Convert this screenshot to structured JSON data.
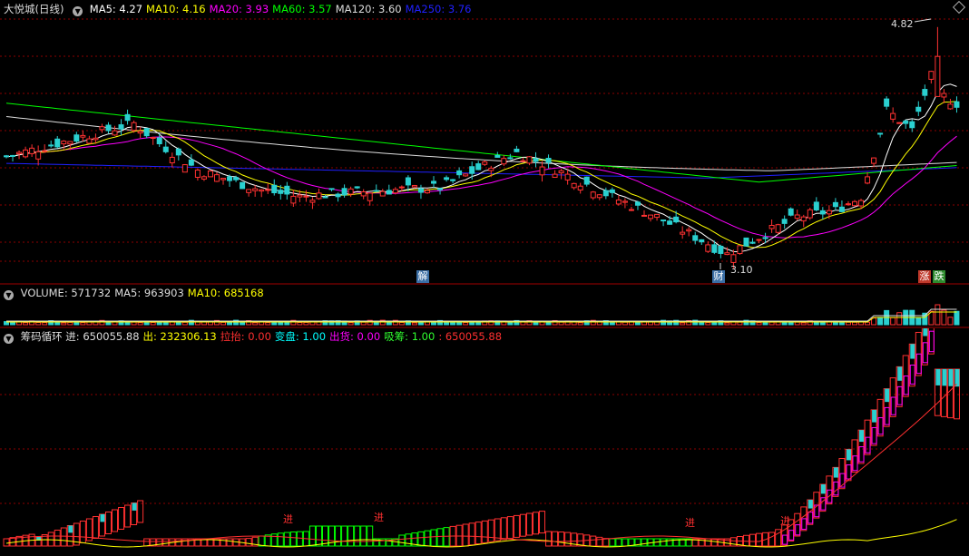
{
  "main_panel": {
    "title": "大悦城(日线)",
    "ma_labels": [
      {
        "text": "MA5: 4.27",
        "color": "#ffffff"
      },
      {
        "text": "MA10: 4.16",
        "color": "#ffff00"
      },
      {
        "text": "MA20: 3.93",
        "color": "#ff00ff"
      },
      {
        "text": "MA60: 3.57",
        "color": "#00ff00"
      },
      {
        "text": "MA120: 3.60",
        "color": "#dddddd"
      },
      {
        "text": "MA250: 3.76",
        "color": "#2020ff"
      }
    ],
    "high_label": "4.82",
    "low_label": "3.10",
    "event_markers": [
      {
        "text": "解",
        "bg": "#3a6ea5"
      },
      {
        "text": "财",
        "bg": "#3a6ea5"
      },
      {
        "text": "涨",
        "bg": "#c0392b"
      },
      {
        "text": "跌",
        "bg": "#2e8b2e"
      }
    ]
  },
  "volume_panel": {
    "labels": [
      {
        "text": "VOLUME: 571732",
        "color": "#dddddd"
      },
      {
        "text": "MA5: 963903",
        "color": "#dddddd"
      },
      {
        "text": "MA10: 685168",
        "color": "#ffff00"
      }
    ]
  },
  "indicator_panel": {
    "labels": [
      {
        "text": "筹码循环 进: 650055.88",
        "color": "#dddddd"
      },
      {
        "text": "出: 232306.13",
        "color": "#ffff00"
      },
      {
        "text": "拉抬: 0.00",
        "color": "#ff3030"
      },
      {
        "text": "变盘: 1.00",
        "color": "#00ffff"
      },
      {
        "text": "出货: 0.00",
        "color": "#ff00ff"
      },
      {
        "text": "吸筹: 1.00",
        "color": "#30ff30"
      },
      {
        "text": ": 650055.88",
        "color": "#ff3030"
      }
    ],
    "signal_text": "进"
  },
  "colors": {
    "up": "#ff3232",
    "down": "#2ad0d0",
    "grid": "#8b0000",
    "ma5": "#ffffff",
    "ma10": "#ffff00",
    "ma20": "#ff00ff",
    "ma60": "#00ff00",
    "ma120": "#dddddd",
    "ma250": "#2020ff"
  }
}
